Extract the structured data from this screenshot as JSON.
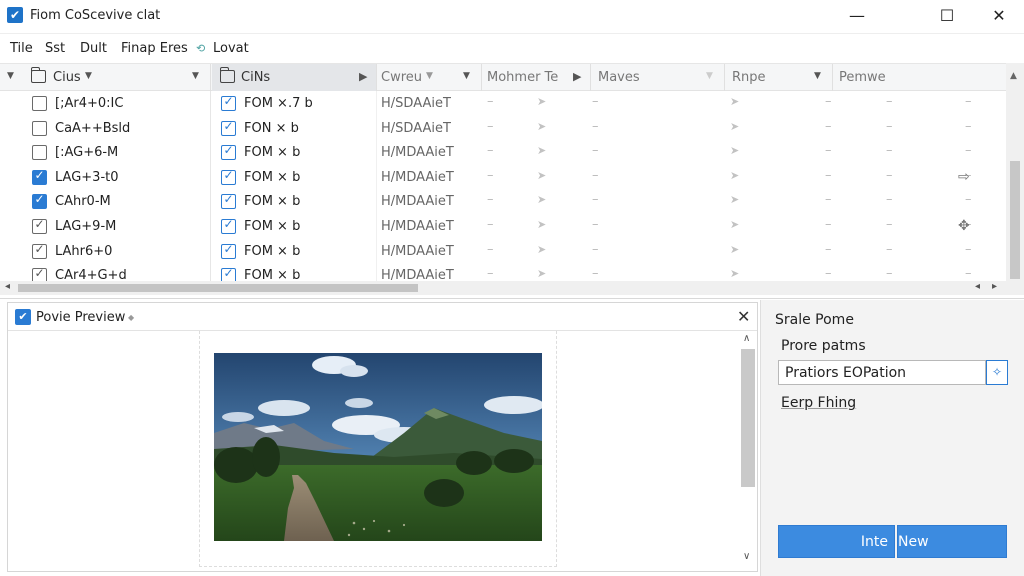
{
  "window": {
    "title": "Fiom CoScevive clat",
    "minimize": "—",
    "maximize": "☐",
    "close": "✕"
  },
  "menu": {
    "items": [
      "Tile",
      "Sst",
      "Dult",
      "Finap Eres",
      "Lovat"
    ]
  },
  "grid": {
    "headers": {
      "col1": "Cius",
      "col2": "CiNs",
      "col3": "Cwreu",
      "col4": "Mohmer Te",
      "col5": "Maves",
      "col6": "Rnpe",
      "col7": "Pemwe"
    },
    "rows": [
      {
        "col1": "[;Ar4+0:IC",
        "col1_checked": false,
        "col2": "FOM ×.7 b",
        "col3": "H/SDAAieT",
        "icon": ""
      },
      {
        "col1": "CaA++Bsld",
        "col1_checked": false,
        "col2": "FON × b",
        "col3": "H/SDAAieT",
        "icon": ""
      },
      {
        "col1": "[:AG+6-M",
        "col1_checked": false,
        "col2": "FOM × b",
        "col3": "H/MDAAieT",
        "icon": ""
      },
      {
        "col1": "LAG+3-t0",
        "col1_checked": true,
        "col2": "FOM × b",
        "col3": "H/MDAAieT",
        "icon": "⇨"
      },
      {
        "col1": "CAhr0-M",
        "col1_checked": true,
        "col2": "FOM × b",
        "col3": "H/MDAAieT",
        "icon": ""
      },
      {
        "col1": "LAG+9-M",
        "col1_checked": true,
        "col2": "FOM × b",
        "col3": "H/MDAAieT",
        "icon": "✥"
      },
      {
        "col1": "LAhr6+0",
        "col1_checked": true,
        "col2": "FOM × b",
        "col3": "H/MDAAieT",
        "icon": ""
      },
      {
        "col1": "CAr4+G+d",
        "col1_checked": true,
        "col2": "FOM × b",
        "col3": "H/MDAAieT",
        "icon": ""
      }
    ]
  },
  "preview": {
    "title": "Povie Preview",
    "close": "✕"
  },
  "right_panel": {
    "title": "Srale Pome",
    "label": "Prore patms",
    "select_value": "Pratiors EOPation",
    "link": "Eerp Fhing",
    "button_left": "Inte",
    "button_right": "New"
  },
  "colors": {
    "accent": "#2a7bd3",
    "button": "#3c8be0"
  }
}
